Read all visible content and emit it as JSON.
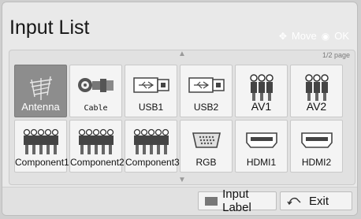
{
  "header": {
    "title": "Input List",
    "move_label": "Move",
    "ok_label": "OK",
    "move_icon": "dpad-arrows-icon",
    "ok_icon": "ok-circle-icon"
  },
  "panel": {
    "page_indicator": "1/2 page",
    "up_arrow": "▲",
    "down_arrow": "▼"
  },
  "inputs": [
    {
      "label": "Antenna",
      "icon": "antenna-icon",
      "selected": true
    },
    {
      "label": "Cable",
      "icon": "cable-connector-icon",
      "selected": false
    },
    {
      "label": "USB1",
      "icon": "usb-icon",
      "selected": false
    },
    {
      "label": "USB2",
      "icon": "usb-icon",
      "selected": false
    },
    {
      "label": "AV1",
      "icon": "av-rca-icon",
      "selected": false
    },
    {
      "label": "AV2",
      "icon": "av-rca-icon",
      "selected": false
    },
    {
      "label": "Component1",
      "icon": "component-rca-icon",
      "selected": false
    },
    {
      "label": "Component2",
      "icon": "component-rca-icon",
      "selected": false
    },
    {
      "label": "Component3",
      "icon": "component-rca-icon",
      "selected": false
    },
    {
      "label": "RGB",
      "icon": "rgb-vga-icon",
      "selected": false
    },
    {
      "label": "HDMI1",
      "icon": "hdmi-icon",
      "selected": false
    },
    {
      "label": "HDMI2",
      "icon": "hdmi-icon",
      "selected": false
    }
  ],
  "footer": {
    "input_label_button": "Input Label",
    "exit_button": "Exit",
    "input_label_color": "#777777",
    "exit_icon": "back-arrow-icon"
  }
}
